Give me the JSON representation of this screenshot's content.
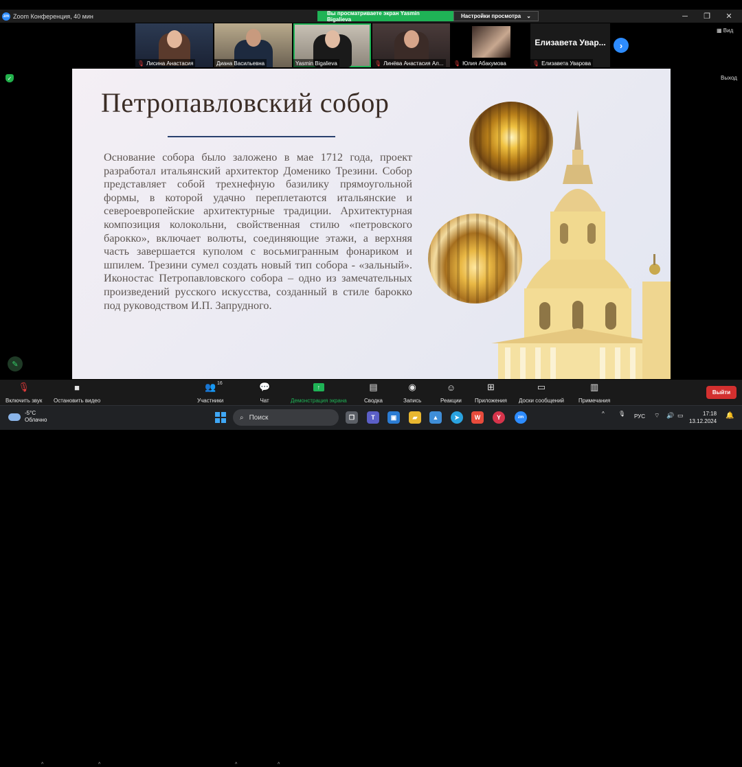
{
  "window": {
    "title": "Zoom Конференция, 40 мин",
    "share_banner": "Вы просматриваете экран Yasmin Bigalieva",
    "view_settings": "Настройки просмотра",
    "view_label": "Вид",
    "exit_label": "Выход"
  },
  "participants": [
    {
      "name": "Лисина Анастасия",
      "muted": true
    },
    {
      "name": "Диана Васильевна",
      "muted": false
    },
    {
      "name": "Yasmin Bigalieva",
      "muted": false
    },
    {
      "name": "Линёва Анастасия Ал...",
      "muted": true
    },
    {
      "name": "Юлия Абакумова",
      "muted": true
    },
    {
      "name": "Елизавета Уварова",
      "muted": true,
      "display": "Елизавета  Увар..."
    }
  ],
  "slide": {
    "title": "Петропавловский собор",
    "body": "Основание собора было заложено в мае 1712 года, проект разработал итальянский архитектор Доменико Трезини. Собор представляет собой трехнефную базилику прямоугольной формы, в которой удачно переплетаются итальянские и североевропейские архитектурные традиции. Архитектурная композиция колокольни, свойственная стилю «петровского барокко», включает волюты, соединяющие этажи, а верхняя часть завершается куполом с восьмигранным фонариком и шпилем. Трезини сумел создать новый тип собора - «зальный». Иконостас Петропавловского собора – одно из замечательных произведений русского искусства, созданный в стиле барокко под руководством И.П. Запрудного."
  },
  "toolbar": {
    "mute": "Включить звук",
    "video": "Остановить видео",
    "participants": "Участники",
    "participants_count": "16",
    "chat": "Чат",
    "share": "Демонстрация экрана",
    "summary": "Сводка",
    "record": "Запись",
    "reactions": "Реакции",
    "apps": "Приложения",
    "whiteboards": "Доски сообщений",
    "notes": "Примечания",
    "leave": "Выйти"
  },
  "taskbar": {
    "weather_temp": "-5°C",
    "weather_desc": "Облачно",
    "search": "Поиск",
    "lang": "РУС",
    "time": "17:18",
    "date": "13.12.2024"
  },
  "colors": {
    "accent_green": "#1fb356",
    "zoom_blue": "#2d8cff",
    "leave_red": "#d3302f",
    "slide_title": "#3b2d26",
    "slide_rule": "#28406e"
  }
}
